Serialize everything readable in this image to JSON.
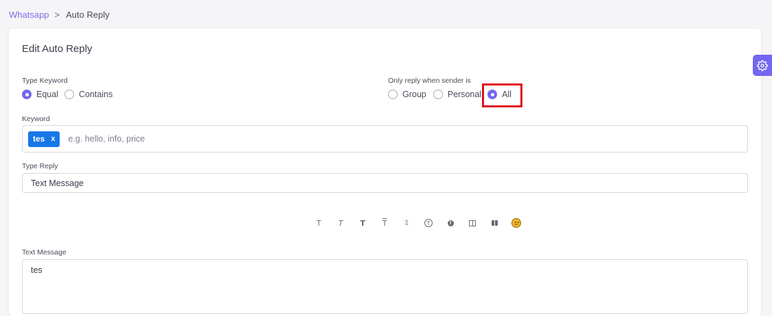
{
  "breadcrumb": {
    "parent": "Whatsapp",
    "separator": ">",
    "current": "Auto Reply"
  },
  "card": {
    "title": "Edit Auto Reply"
  },
  "type_keyword": {
    "label": "Type Keyword",
    "options": [
      "Equal",
      "Contains"
    ],
    "selected": "Equal"
  },
  "sender": {
    "label": "Only reply when sender is",
    "options": [
      "Group",
      "Personal",
      "All"
    ],
    "selected": "All"
  },
  "keyword": {
    "label": "Keyword",
    "tags": [
      "tes"
    ],
    "tag_close": "x",
    "placeholder": "e.g. hello, info, price"
  },
  "type_reply": {
    "label": "Type Reply",
    "value": "Text Message"
  },
  "toolbar": {
    "icons": [
      "text-normal-icon",
      "text-italic-icon",
      "text-bold-icon",
      "text-strike-icon",
      "text-mono-icon",
      "circle-t-icon",
      "info-dot-icon",
      "columns-icon",
      "book-icon",
      "smile-emoji-icon"
    ]
  },
  "text_message": {
    "label": "Text Message",
    "value": "tes"
  },
  "colors": {
    "accent": "#7367f0",
    "tag": "#1677e8",
    "highlight": "#e0101a"
  }
}
